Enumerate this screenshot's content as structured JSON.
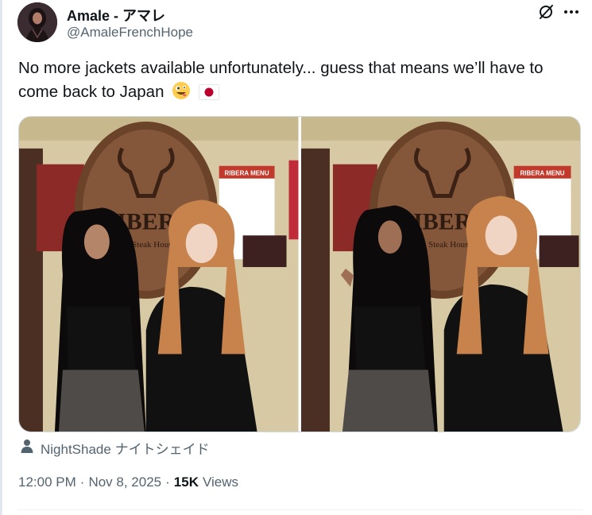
{
  "author": {
    "display_name": "Amale - アマレ",
    "handle": "@AmaleFrenchHope"
  },
  "tweet": {
    "text": "No more jackets available unfortunately... guess that means we’ll have to come back to Japan",
    "emojis": [
      "zany-face-emoji",
      "japan-flag-emoji"
    ]
  },
  "media": {
    "photos": [
      {
        "sign_text": "RIBERA",
        "sign_sub": "Steak House",
        "menu_title": "RIBERA MENU"
      },
      {
        "sign_text": "RIBERA",
        "sign_sub": "Steak House",
        "menu_title": "RIBERA MENU"
      }
    ],
    "tagged_user": "NightShade ナイトシェイド"
  },
  "meta": {
    "time": "12:00 PM",
    "separator": "·",
    "date": "Nov 8, 2025",
    "views_count": "15K",
    "views_label": "Views"
  },
  "icons": {
    "grok": "grok-icon",
    "more": "more-icon",
    "person": "person-icon"
  },
  "colors": {
    "text_primary": "#0f1419",
    "text_secondary": "#536471",
    "border": "#cfd9de"
  }
}
